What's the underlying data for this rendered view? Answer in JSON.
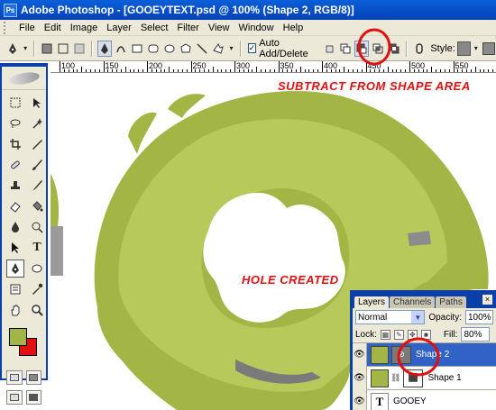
{
  "window": {
    "title": "Adobe Photoshop - [GOOEYTEXT.psd @ 100% (Shape 2, RGB/8)]"
  },
  "menu": {
    "items": [
      "File",
      "Edit",
      "Image",
      "Layer",
      "Select",
      "Filter",
      "View",
      "Window",
      "Help"
    ]
  },
  "options_bar": {
    "auto_add_label": "Auto Add/Delete",
    "auto_add_checked": true,
    "style_label": "Style:",
    "shape_area_modes": [
      "add-to-shape-area",
      "subtract-from-shape-area",
      "intersect-shape-areas",
      "exclude-overlapping-shape-areas"
    ],
    "selected_mode": "subtract-from-shape-area"
  },
  "ruler": {
    "labels": [
      "100",
      "150",
      "200",
      "250",
      "300",
      "350",
      "400",
      "450",
      "500",
      "550"
    ]
  },
  "canvas": {
    "annotation_top": "SUBTRACT FROM SHAPE AREA",
    "annotation_center": "HOLE CREATED",
    "shape_color_outer": "#a3b544",
    "shape_color_inner": "#b6c95a"
  },
  "toolbox": {
    "tools": [
      "marquee-icon",
      "move-icon",
      "lasso-icon",
      "magic-wand-icon",
      "crop-icon",
      "slice-icon",
      "healing-brush-icon",
      "brush-icon",
      "clone-stamp-icon",
      "history-brush-icon",
      "eraser-icon",
      "paint-bucket-icon",
      "blur-icon",
      "dodge-icon",
      "path-selection-icon",
      "type-icon",
      "pen-icon",
      "shape-icon",
      "notes-icon",
      "eyedropper-icon",
      "hand-icon",
      "zoom-icon"
    ],
    "foreground_color": "#a3b544",
    "background_color": "#e01010"
  },
  "layers_panel": {
    "tabs": [
      "Layers",
      "Channels",
      "Paths"
    ],
    "active_tab": "Layers",
    "blend_mode": "Normal",
    "opacity_label": "Opacity:",
    "opacity": "100%",
    "lock_label": "Lock:",
    "fill_label": "Fill:",
    "fill": "80%",
    "layers": [
      {
        "name": "Shape 2",
        "selected": true
      },
      {
        "name": "Shape 1",
        "selected": false
      },
      {
        "name": "GOOEY",
        "selected": false,
        "type": "text",
        "thumb_glyph": "T"
      }
    ]
  }
}
